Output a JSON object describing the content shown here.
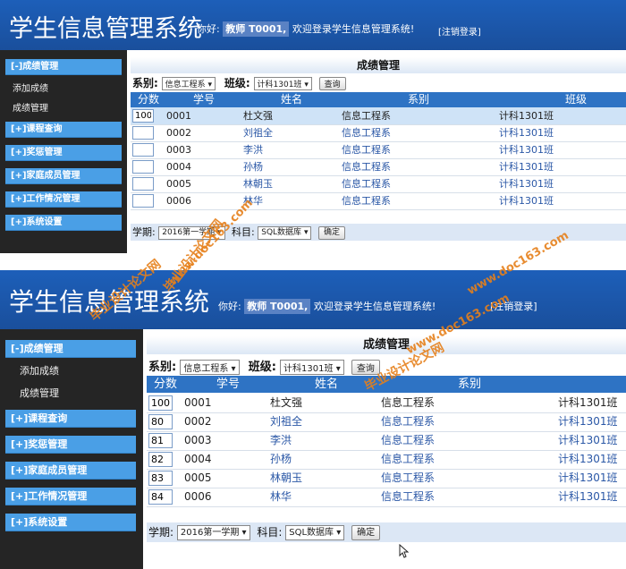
{
  "app": {
    "title": "学生信息管理系统",
    "greeting_prefix": "你好:",
    "role": "教师 T0001,",
    "greeting_suffix": "欢迎登录学生信息管理系统!",
    "logout": "[注销登录]"
  },
  "sidebar": {
    "grade_mgmt": "[-]成绩管理",
    "add_grade": "添加成绩",
    "grade_manage": "成绩管理",
    "course_query": "[+]课程查询",
    "reward_mgmt": "[+]奖惩管理",
    "family_mgmt": "[+]家庭成员管理",
    "work_mgmt": "[+]工作情况管理",
    "system_settings": "[+]系统设置"
  },
  "main": {
    "title": "成绩管理",
    "dept_label": "系别:",
    "dept_value": "信息工程系",
    "class_label": "班级:",
    "class_value": "计科1301班",
    "query_button": "查询",
    "columns": [
      "分数",
      "学号",
      "姓名",
      "系别",
      "班级"
    ],
    "semester_label": "学期:",
    "semester_value_top": "2016第一学期",
    "semester_value": "2016第一学期",
    "subject_label": "科目:",
    "subject_value": "SQL数据库",
    "confirm_button": "确定"
  },
  "top_rows": [
    {
      "score": "100",
      "id": "0001",
      "name": "杜文强",
      "dept": "信息工程系",
      "cls": "计科1301班"
    },
    {
      "score": "",
      "id": "0002",
      "name": "刘祖全",
      "dept": "信息工程系",
      "cls": "计科1301班"
    },
    {
      "score": "",
      "id": "0003",
      "name": "李洪",
      "dept": "信息工程系",
      "cls": "计科1301班"
    },
    {
      "score": "",
      "id": "0004",
      "name": "孙杨",
      "dept": "信息工程系",
      "cls": "计科1301班"
    },
    {
      "score": "",
      "id": "0005",
      "name": "林朝玉",
      "dept": "信息工程系",
      "cls": "计科1301班"
    },
    {
      "score": "",
      "id": "0006",
      "name": "林华",
      "dept": "信息工程系",
      "cls": "计科1301班"
    }
  ],
  "bottom_rows": [
    {
      "score": "100",
      "id": "0001",
      "name": "杜文强",
      "dept": "信息工程系",
      "cls": "计科1301班"
    },
    {
      "score": "80",
      "id": "0002",
      "name": "刘祖全",
      "dept": "信息工程系",
      "cls": "计科1301班"
    },
    {
      "score": "81",
      "id": "0003",
      "name": "李洪",
      "dept": "信息工程系",
      "cls": "计科1301班"
    },
    {
      "score": "82",
      "id": "0004",
      "name": "孙杨",
      "dept": "信息工程系",
      "cls": "计科1301班"
    },
    {
      "score": "83",
      "id": "0005",
      "name": "林朝玉",
      "dept": "信息工程系",
      "cls": "计科1301班"
    },
    {
      "score": "84",
      "id": "0006",
      "name": "林华",
      "dept": "信息工程系",
      "cls": "计科1301班"
    }
  ],
  "watermark": {
    "site_cn": "毕业设计论文网",
    "site_url": "www.doc163.com"
  },
  "icons": {
    "dropdown": "chevron-down-icon",
    "cursor": "mouse-pointer-icon"
  }
}
